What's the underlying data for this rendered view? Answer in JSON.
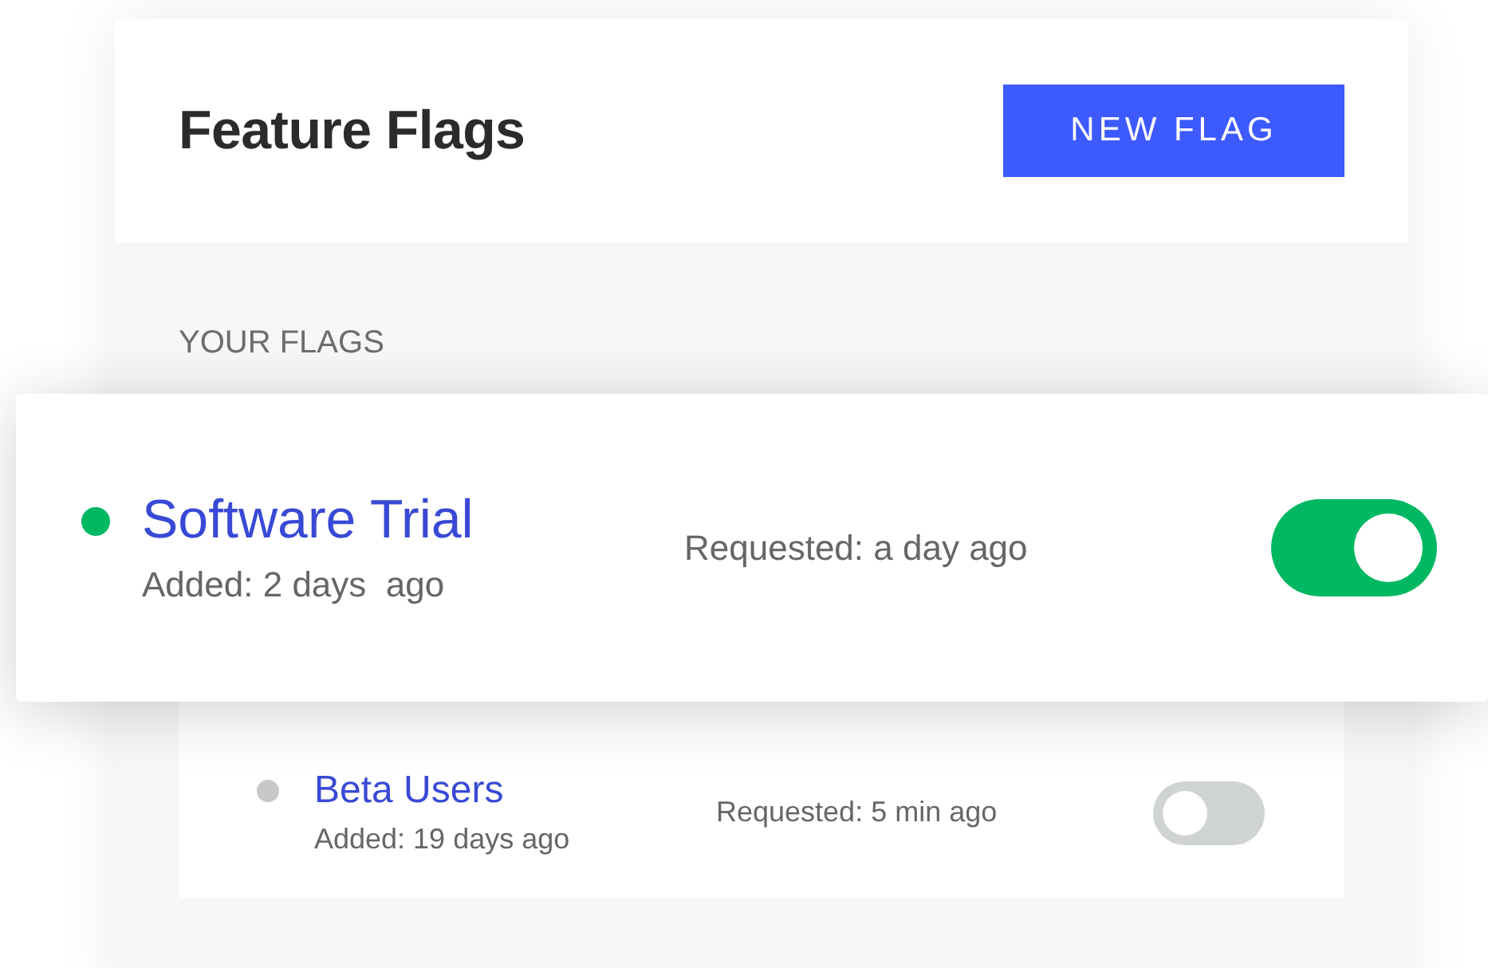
{
  "header": {
    "title": "Feature Flags",
    "button": "NEW FLAG"
  },
  "section_label": "YOUR FLAGS",
  "flags": [
    {
      "name": "Software Trial",
      "added": "Added: 2 days  ago",
      "requested": "Requested: a day ago",
      "on": true,
      "highlighted": true,
      "color": "#00b862"
    },
    {
      "name": "Beta Users",
      "added": "Added: 19 days ago",
      "requested": "Requested: 5 min ago",
      "on": false,
      "highlighted": false,
      "color": "#c8c8c8"
    }
  ]
}
